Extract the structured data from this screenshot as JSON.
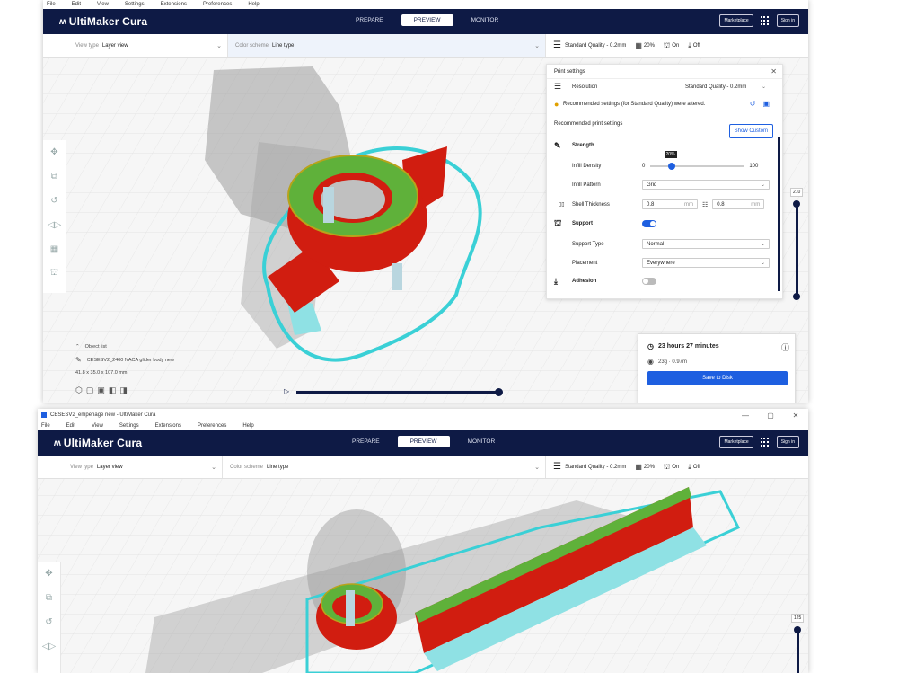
{
  "colors": {
    "header_bg": "#0e1a45",
    "accent": "#1e5fe0",
    "model_red": "#d11d10",
    "infill_green": "#5fb13a",
    "skirt_cyan": "#3ad0d6"
  },
  "window1": {
    "menu": [
      "File",
      "Edit",
      "View",
      "Settings",
      "Extensions",
      "Preferences",
      "Help"
    ],
    "header": {
      "logo_text": "UltiMaker Cura",
      "stages": [
        "PREPARE",
        "PREVIEW",
        "MONITOR"
      ],
      "active_stage": "PREVIEW",
      "marketplace_label": "Marketplace",
      "signin_label": "Sign in"
    },
    "toolbar": {
      "view_type_label": "View type",
      "view_type_value": "Layer view",
      "color_scheme_label": "Color scheme",
      "color_scheme_value": "Line type",
      "quality": "Standard Quality - 0.2mm",
      "infill": "20%",
      "support": "On",
      "adhesion": "Off"
    },
    "left_tools": [
      "move-icon",
      "scale-icon",
      "rotate-icon",
      "mirror-icon",
      "per-model-settings-icon",
      "support-blocker-icon"
    ],
    "print_settings": {
      "title": "Print settings",
      "resolution_label": "Resolution",
      "resolution_value": "Standard Quality - 0.2mm",
      "warning_text": "Recommended settings (for Standard Quality) were altered.",
      "recommended_label": "Recommended print settings",
      "show_custom_label": "Show Custom",
      "strength_label": "Strength",
      "infill_density_label": "Infill Density",
      "infill_min": "0",
      "infill_max": "100",
      "infill_value_label": "20%",
      "infill_value": 20,
      "infill_pattern_label": "Infill Pattern",
      "infill_pattern_value": "Grid",
      "shell_thickness_label": "Shell Thickness",
      "wall_thickness": "0.8",
      "top_bottom_thickness": "0.8",
      "unit": "mm",
      "support_label": "Support",
      "support_enabled": true,
      "support_type_label": "Support Type",
      "support_type_value": "Normal",
      "placement_label": "Placement",
      "placement_value": "Everywhere",
      "adhesion_label": "Adhesion",
      "adhesion_enabled": false
    },
    "layer_slider": {
      "value_label": "210"
    },
    "object_list": {
      "header": "Object list",
      "object_name": "CESESV2_2400 NACA glider body new",
      "dimensions": "41.8 x 35.0 x 107.0 mm"
    },
    "estimate": {
      "time": "23 hours 27 minutes",
      "material": "23g · 0.97m",
      "save_label": "Save to Disk"
    }
  },
  "window2": {
    "title": "CESESV2_empenage new - UltiMaker Cura",
    "window_controls": [
      "—",
      "▢",
      "✕"
    ],
    "menu": [
      "File",
      "Edit",
      "View",
      "Settings",
      "Extensions",
      "Preferences",
      "Help"
    ],
    "header": {
      "logo_text": "UltiMaker Cura",
      "stages": [
        "PREPARE",
        "PREVIEW",
        "MONITOR"
      ],
      "active_stage": "PREVIEW",
      "marketplace_label": "Marketplace",
      "signin_label": "Sign in"
    },
    "toolbar": {
      "view_type_label": "View type",
      "view_type_value": "Layer view",
      "color_scheme_label": "Color scheme",
      "color_scheme_value": "Line type",
      "quality": "Standard Quality - 0.2mm",
      "infill": "20%",
      "support": "On",
      "adhesion": "Off"
    },
    "layer_slider": {
      "value_label": "125"
    }
  }
}
